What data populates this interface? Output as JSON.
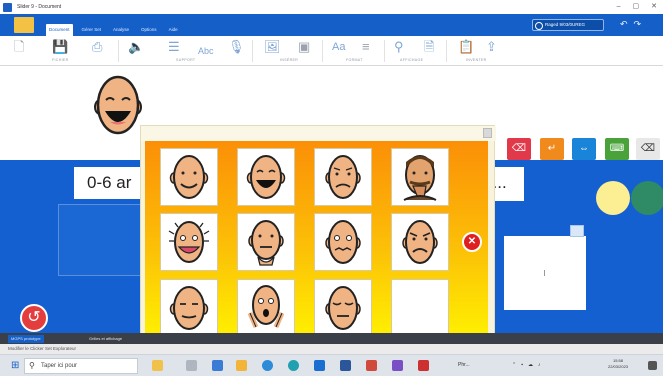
{
  "window": {
    "title": "Slider 9 - Document"
  },
  "ribbon": {
    "tabs": [
      "Document",
      "Gérer Set",
      "Analyse",
      "Options",
      "Aide"
    ],
    "active_tab": "Document",
    "user_label": "Raged 9/03/0UREG",
    "groups": [
      "FICHIER",
      "SUPPORT",
      "INSÉRER",
      "FORMAT",
      "AFFICHAGE",
      "INVENTER"
    ]
  },
  "work": {
    "age_text": "0-6 ar",
    "card_s_text": "s..."
  },
  "popup": {
    "faces": [
      "smile",
      "laugh",
      "worried",
      "hand-mouth",
      "surprised",
      "chin-hand",
      "scared",
      "frown",
      "calm",
      "shocked-hands",
      "eyes-closed",
      "empty"
    ]
  },
  "taskbar": {
    "search_placeholder": "Taper ici pour",
    "status_text": "Modifier le Clicker Set   Explorateur",
    "doc_tabs": [
      "MGPS prototype",
      "Grilles et affichage"
    ],
    "app_label": "Phr...",
    "time": "15:58",
    "date": "22/03/2023"
  },
  "colors": {
    "ribbon_blue": "#1560c8",
    "work_blue": "#1460d0",
    "popup_top": "#fb8f07",
    "popup_bottom": "#fff200",
    "accent_red": "#e43d3d"
  },
  "icons": [
    "new-file-icon",
    "save-icon",
    "print-icon",
    "speaker-icon",
    "list-icon",
    "spell-icon",
    "mic-icon",
    "image-icon",
    "insert-icon",
    "font-icon",
    "align-icon",
    "zoom-icon",
    "page-icon",
    "paste-icon",
    "export-icon"
  ]
}
